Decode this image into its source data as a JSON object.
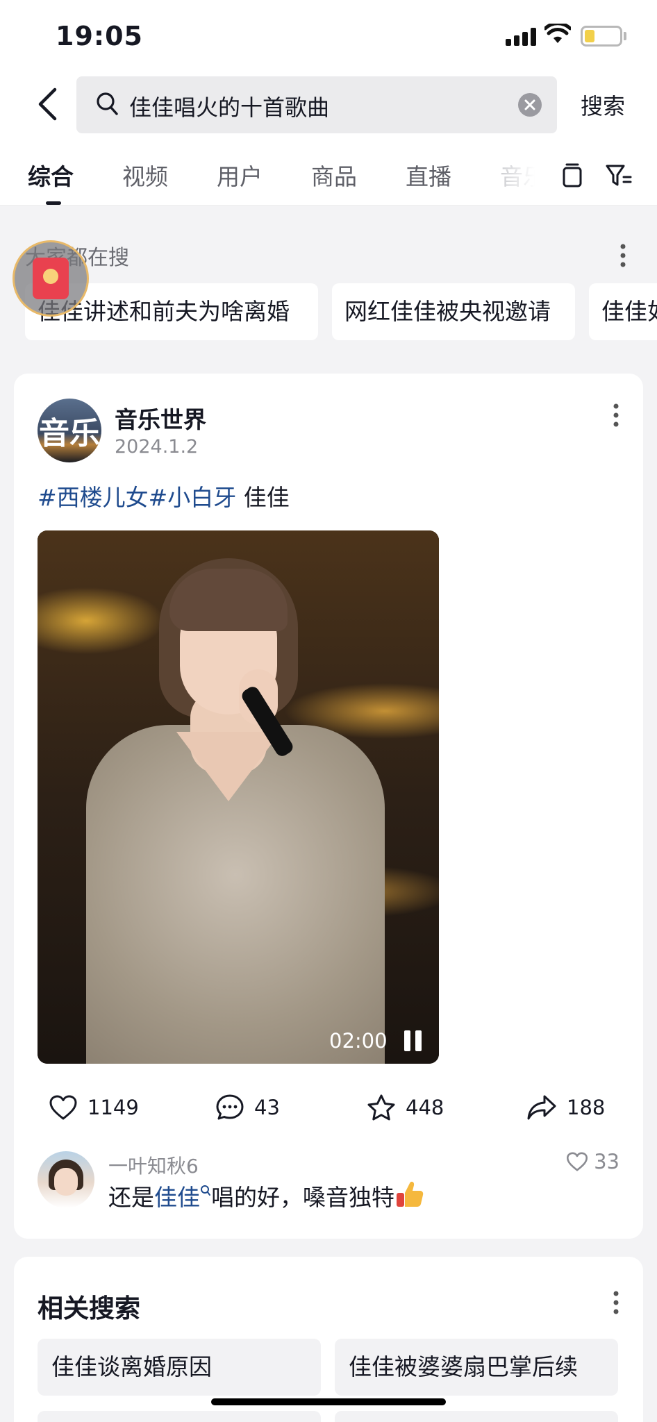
{
  "status": {
    "time": "19:05"
  },
  "search": {
    "query": "佳佳唱火的十首歌曲",
    "button_label": "搜索"
  },
  "tabs": [
    "综合",
    "视频",
    "用户",
    "商品",
    "直播",
    "音乐"
  ],
  "trending": {
    "title": "大家都在搜",
    "items": [
      "佳佳讲述和前夫为啥离婚",
      "网红佳佳被央视邀请",
      "佳佳如"
    ]
  },
  "post": {
    "avatar_text": "音乐",
    "author": "音乐世界",
    "date": "2024.1.2",
    "hashtags": [
      "#西楼儿女",
      "#小白牙"
    ],
    "caption_text": " 佳佳",
    "video": {
      "duration": "02:00"
    },
    "actions": {
      "likes": "1149",
      "comments": "43",
      "favorites": "448",
      "shares": "188"
    },
    "top_comment": {
      "user": "一叶知秋6",
      "text_before": "还是",
      "keyword": "佳佳",
      "text_after": "唱的好，嗓音独特",
      "likes": "33"
    }
  },
  "related": {
    "title": "相关搜索",
    "items": [
      "佳佳谈离婚原因",
      "佳佳被婆婆扇巴掌后续"
    ]
  },
  "colors": {
    "link": "#1f4b8e",
    "background": "#f3f3f5"
  }
}
